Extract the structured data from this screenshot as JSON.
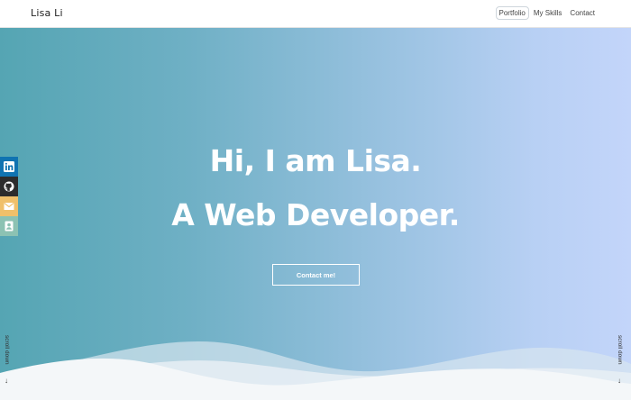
{
  "navbar": {
    "brand": "Lisa Li",
    "links": [
      {
        "label": "Portfolio"
      },
      {
        "label": "My Skills"
      },
      {
        "label": "Contact"
      }
    ]
  },
  "hero": {
    "line1": "Hi, I am Lisa.",
    "line2": "A Web Developer.",
    "cta_label": "Contact me!"
  },
  "social": [
    {
      "icon": "linkedin-icon",
      "color": "#1073b1"
    },
    {
      "icon": "github-icon",
      "color": "#2c2c2c"
    },
    {
      "icon": "mail-icon",
      "color": "#f0c06a"
    },
    {
      "icon": "contact-card-icon",
      "color": "#8cc2b3"
    }
  ],
  "scroll": {
    "label": "scroll down",
    "arrow": "↓"
  },
  "colors": {
    "gradient_start": "#55a5b3",
    "gradient_end": "#c3d5fa",
    "wave": "#f4f7f9"
  }
}
